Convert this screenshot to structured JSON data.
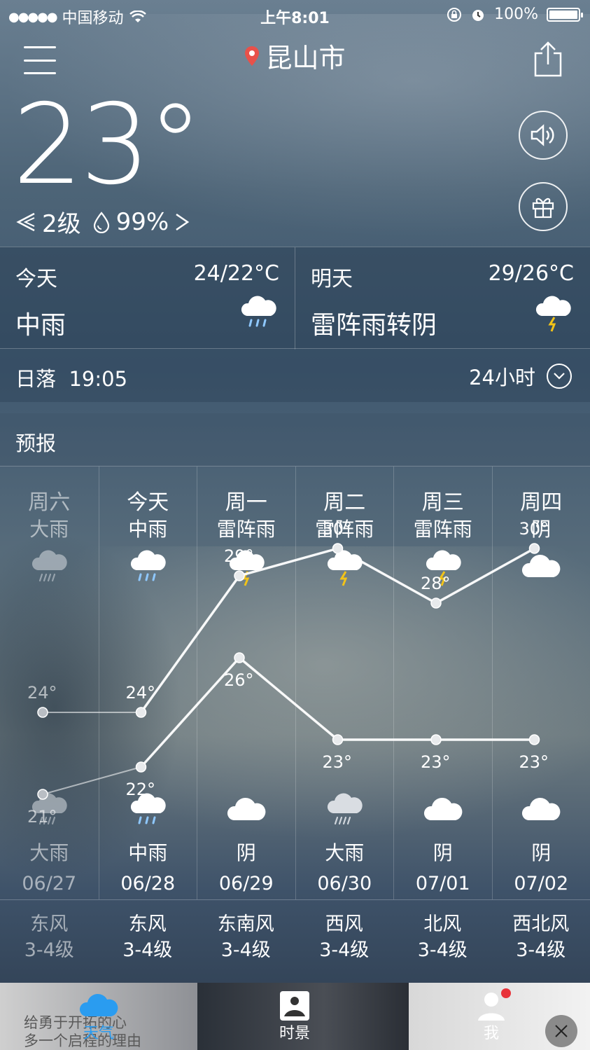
{
  "status_bar": {
    "carrier": "中国移动",
    "time": "上午8:01",
    "battery": "100%"
  },
  "header": {
    "city": "昆山市"
  },
  "current": {
    "temperature": "23°",
    "wind_level": "2级",
    "humidity": "99%"
  },
  "today": {
    "label": "今天",
    "range": "24/22°C",
    "condition": "中雨",
    "icon": "rain-moderate-icon"
  },
  "tomorrow": {
    "label": "明天",
    "range": "29/26°C",
    "condition": "雷阵雨转阴",
    "icon": "thunder-rain-icon"
  },
  "sunset": {
    "label": "日落",
    "time": "19:05",
    "hourly_label": "24小时"
  },
  "forecast": {
    "title": "预报",
    "days": [
      {
        "day": "周六",
        "day_cond": "大雨",
        "day_icon": "rain-heavy-icon",
        "high": "24°",
        "low": "21°",
        "night_icon": "rain-heavy-icon",
        "night_cond": "大雨",
        "date": "06/27",
        "wind_dir": "东风",
        "wind_level": "3-4级",
        "past": true
      },
      {
        "day": "今天",
        "day_cond": "中雨",
        "day_icon": "rain-moderate-icon",
        "high": "24°",
        "low": "22°",
        "night_icon": "rain-moderate-icon",
        "night_cond": "中雨",
        "date": "06/28",
        "wind_dir": "东风",
        "wind_level": "3-4级",
        "past": false
      },
      {
        "day": "周一",
        "day_cond": "雷阵雨",
        "day_icon": "thunder-rain-icon",
        "high": "29°",
        "low": "26°",
        "night_icon": "cloudy-icon",
        "night_cond": "阴",
        "date": "06/29",
        "wind_dir": "东南风",
        "wind_level": "3-4级",
        "past": false
      },
      {
        "day": "周二",
        "day_cond": "雷阵雨",
        "day_icon": "thunder-rain-icon",
        "high": "30°",
        "low": "23°",
        "night_icon": "rain-heavy-icon",
        "night_cond": "大雨",
        "date": "06/30",
        "wind_dir": "西风",
        "wind_level": "3-4级",
        "past": false
      },
      {
        "day": "周三",
        "day_cond": "雷阵雨",
        "day_icon": "thunder-rain-icon",
        "high": "28°",
        "low": "23°",
        "night_icon": "cloudy-icon",
        "night_cond": "阴",
        "date": "07/01",
        "wind_dir": "北风",
        "wind_level": "3-4级",
        "past": false
      },
      {
        "day": "周四",
        "day_cond": "阴",
        "day_icon": "cloudy-icon",
        "high": "30°",
        "low": "23°",
        "night_icon": "cloudy-icon",
        "night_cond": "阴",
        "date": "07/02",
        "wind_dir": "西北风",
        "wind_level": "3-4级",
        "past": false
      }
    ]
  },
  "chart_data": {
    "type": "line",
    "categories": [
      "06/27",
      "06/28",
      "06/29",
      "06/30",
      "07/01",
      "07/02"
    ],
    "series": [
      {
        "values": [
          24,
          24,
          29,
          30,
          28,
          30
        ]
      },
      {
        "values": [
          21,
          22,
          26,
          23,
          23,
          23
        ]
      }
    ]
  },
  "ad": {
    "text_line1": "给勇于开拓的心",
    "text_line2": "多一个启程的理由"
  },
  "tabbar": {
    "weather": "天气",
    "scenery": "时景",
    "me": "我"
  },
  "colors": {
    "active_tab": "#2a9cf0",
    "location_pin": "#e8514a",
    "badge": "#e8333a",
    "lightning": "#f2c318"
  }
}
